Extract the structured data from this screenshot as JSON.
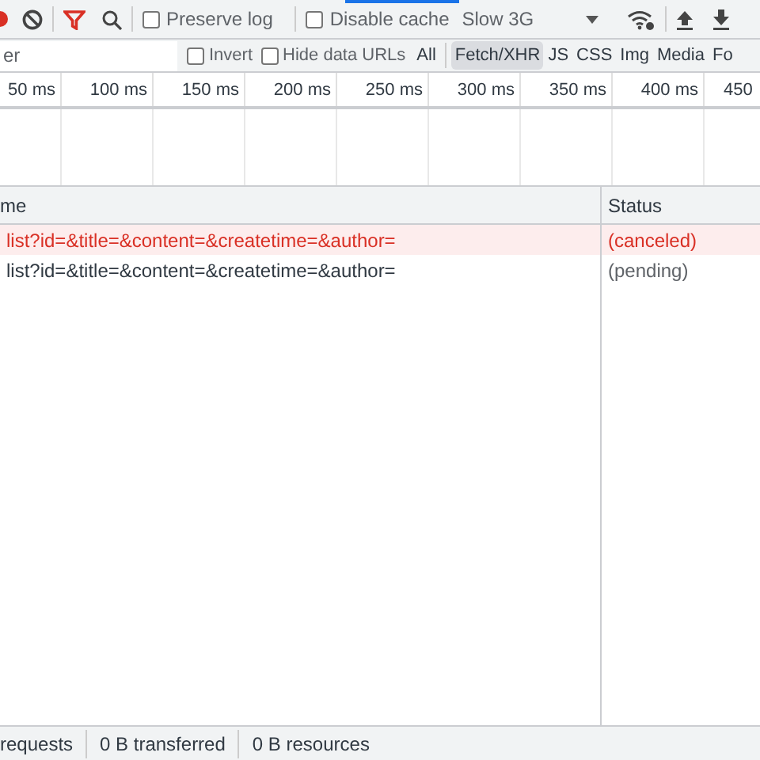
{
  "toolbar": {
    "recording": true,
    "filter_active": true,
    "preserve_log": {
      "label": "Preserve log",
      "checked": false
    },
    "disable_cache": {
      "label": "Disable cache",
      "checked": false
    },
    "throttling": "Slow 3G"
  },
  "filter_bar": {
    "placeholder": "er",
    "invert": {
      "label": "Invert",
      "checked": false
    },
    "hide_data_urls": {
      "label": "Hide data URLs",
      "checked": false
    },
    "types": [
      {
        "label": "All",
        "selected": false
      },
      {
        "label": "Fetch/XHR",
        "selected": true
      },
      {
        "label": "JS",
        "selected": false
      },
      {
        "label": "CSS",
        "selected": false
      },
      {
        "label": "Img",
        "selected": false
      },
      {
        "label": "Media",
        "selected": false
      },
      {
        "label": "Fo",
        "selected": false
      }
    ]
  },
  "timeline": {
    "ticks": [
      "50 ms",
      "100 ms",
      "150 ms",
      "200 ms",
      "250 ms",
      "300 ms",
      "350 ms",
      "400 ms",
      "450"
    ]
  },
  "table": {
    "columns": [
      "me",
      "Status"
    ],
    "rows": [
      {
        "name": "list?id=&title=&content=&createtime=&author=",
        "status": "(canceled)",
        "failed": true
      },
      {
        "name": "list?id=&title=&content=&createtime=&author=",
        "status": "(pending)",
        "failed": false
      }
    ]
  },
  "status_bar": [
    "requests",
    "0 B transferred",
    "0 B resources"
  ]
}
